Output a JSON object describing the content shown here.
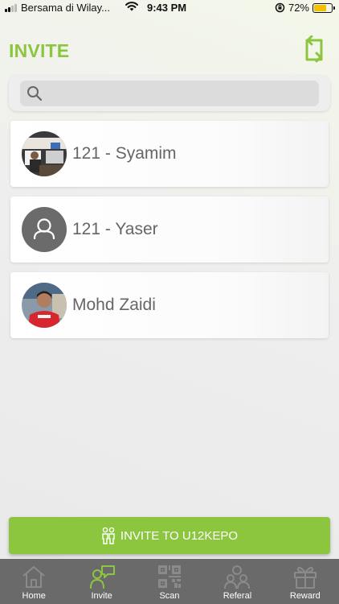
{
  "status_bar": {
    "carrier": "Bersama di Wilay...",
    "time": "9:43 PM",
    "battery": "72%",
    "battery_level": 0.72
  },
  "header": {
    "title": "INVITE"
  },
  "search": {
    "placeholder": ""
  },
  "contacts": [
    {
      "name": "121 - Syamim",
      "avatar": "photo"
    },
    {
      "name": "121 - Yaser",
      "avatar": "default-person"
    },
    {
      "name": "Mohd Zaidi",
      "avatar": "photo"
    }
  ],
  "invite_button": {
    "label": "INVITE TO U12KEPO"
  },
  "tabs": [
    {
      "label": "Home",
      "icon": "home-icon",
      "active": false
    },
    {
      "label": "Invite",
      "icon": "invite-icon",
      "active": true
    },
    {
      "label": "Scan",
      "icon": "qr-code-icon",
      "active": false
    },
    {
      "label": "Referal",
      "icon": "group-icon",
      "active": false
    },
    {
      "label": "Reward",
      "icon": "gift-icon",
      "active": false
    }
  ],
  "colors": {
    "accent": "#8cc63f",
    "tabbar": "#6a6a6a",
    "tab_inactive_icon": "#8a8a8a"
  }
}
